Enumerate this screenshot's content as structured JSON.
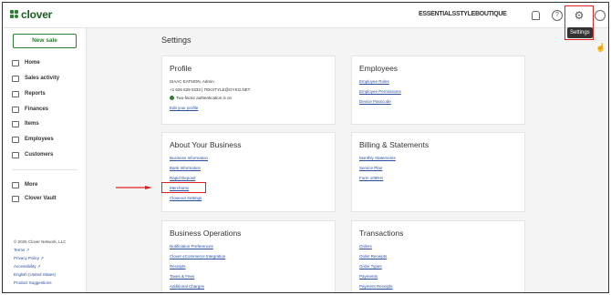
{
  "app": {
    "logo_text": "clover",
    "merchant_name": "ESSENTIALSSTYLEBOUTIQUE",
    "tooltip": "Settings"
  },
  "topbar": {
    "icons": [
      "bell-icon",
      "help-icon",
      "gear-icon",
      "account-icon"
    ],
    "help_glyph": "?",
    "gear_glyph": "⚙"
  },
  "sidebar": {
    "new_sale": "New sale",
    "items": [
      {
        "label": "Home",
        "icon": "home-icon"
      },
      {
        "label": "Sales activity",
        "icon": "receipt-icon"
      },
      {
        "label": "Reports",
        "icon": "chart-icon"
      },
      {
        "label": "Finances",
        "icon": "bank-icon"
      },
      {
        "label": "Items",
        "icon": "tag-icon"
      },
      {
        "label": "Employees",
        "icon": "people-icon"
      },
      {
        "label": "Customers",
        "icon": "customers-icon"
      }
    ],
    "more_items": [
      {
        "label": "More",
        "icon": "more-icon"
      },
      {
        "label": "Clover Vault",
        "icon": "vault-icon"
      }
    ],
    "footer": {
      "copyright": "© 2025 Clover Network, LLC",
      "terms": "Terms",
      "privacy": "Privacy Policy",
      "accessibility": "Accessibility",
      "language": "English (United States)",
      "suggestions": "Product Suggestions",
      "external_glyph": "↗"
    }
  },
  "page": {
    "title": "Settings"
  },
  "profile": {
    "title": "Profile",
    "name": "ISAAC EATMON, Admin",
    "contact": "+1 626 629 0333 | TEKSTYLE@GYKO.NET",
    "two_factor": "Two-factor authentication is on",
    "edit_link": "Edit your profile"
  },
  "employees": {
    "title": "Employees",
    "links": [
      "Employee Roles",
      "Employee Permissions",
      "Device Passcode"
    ]
  },
  "business": {
    "title": "About Your Business",
    "links": [
      "Business Information",
      "Bank Information",
      "Rapid Deposit",
      "Merchants",
      "Closeout Settings"
    ]
  },
  "billing": {
    "title": "Billing & Statements",
    "links": [
      "Monthly Statements",
      "Service Plan",
      "Form 1099-K"
    ]
  },
  "operations": {
    "title": "Business Operations",
    "links": [
      "Notification Preferences",
      "Clover eCommerce Integration",
      "Receipts",
      "Taxes & Fees",
      "Additional Charges"
    ]
  },
  "transactions": {
    "title": "Transactions",
    "links": [
      "Orders",
      "Order Receipts",
      "Order Types",
      "Payments",
      "Payment Receipts"
    ]
  },
  "colors": {
    "brand": "#2e7d32",
    "link": "#2a4da0",
    "highlight": "#e02020"
  }
}
